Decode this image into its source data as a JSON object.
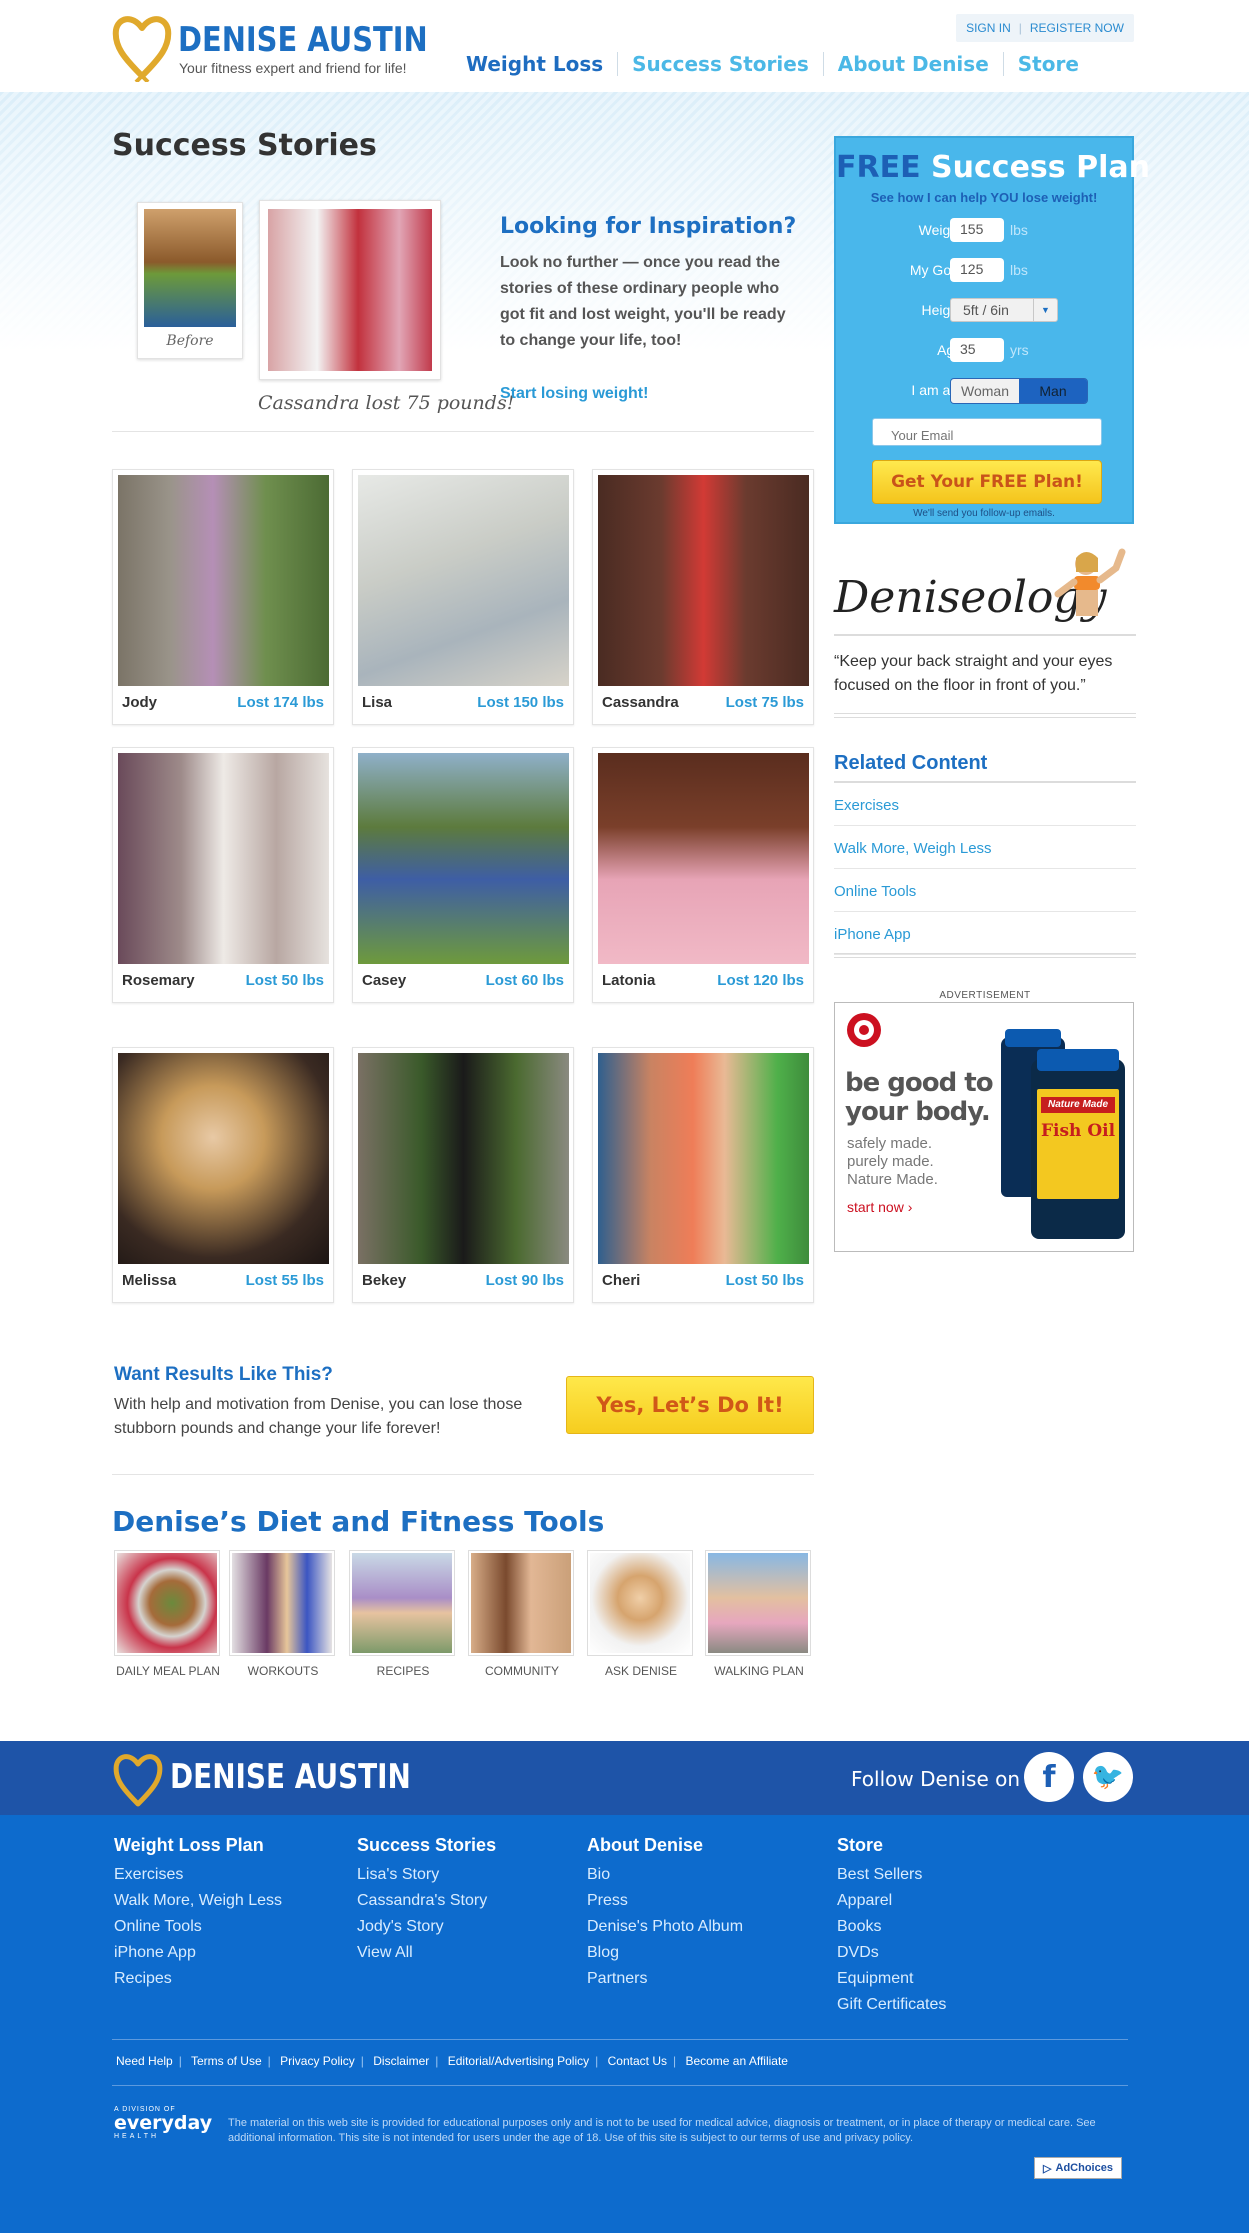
{
  "header": {
    "brand": "DENISE AUSTIN",
    "tagline": "Your fitness expert and friend for life!",
    "sign_in": "SIGN IN",
    "register": "REGISTER NOW",
    "nav": [
      "Weight Loss",
      "Success Stories",
      "About Denise",
      "Store"
    ],
    "active_nav": "Weight Loss"
  },
  "page": {
    "title": "Success Stories",
    "hero": {
      "before_caption": "Before",
      "after_caption": "Cassandra lost 75 pounds!",
      "heading": "Looking for Inspiration?",
      "body": "Look no further — once you read the stories of these ordinary people who got fit and lost weight, you'll be ready to change your life, too!",
      "link": "Start losing weight!"
    },
    "stories": [
      {
        "name": "Jody",
        "lost": "Lost 174 lbs"
      },
      {
        "name": "Lisa",
        "lost": "Lost 150 lbs"
      },
      {
        "name": "Cassandra",
        "lost": "Lost 75 lbs"
      },
      {
        "name": "Rosemary",
        "lost": "Lost 50 lbs"
      },
      {
        "name": "Casey",
        "lost": "Lost 60 lbs"
      },
      {
        "name": "Latonia",
        "lost": "Lost 120 lbs"
      },
      {
        "name": "Melissa",
        "lost": "Lost 55 lbs"
      },
      {
        "name": "Bekey",
        "lost": "Lost 90 lbs"
      },
      {
        "name": "Cheri",
        "lost": "Lost 50 lbs"
      }
    ],
    "cta": {
      "heading": "Want Results Like This?",
      "body": "With help and motivation from Denise, you can lose those stubborn pounds and change your life forever!",
      "button": "Yes, Let’s Do It!"
    },
    "tools": {
      "heading": "Denise’s Diet and Fitness Tools",
      "items": [
        "DAILY MEAL PLAN",
        "WORKOUTS",
        "RECIPES",
        "COMMUNITY",
        "ASK DENISE",
        "WALKING PLAN"
      ]
    }
  },
  "sidebar": {
    "plan": {
      "title_free": "FREE",
      "title_rest": "Success Plan",
      "subtitle": "See how I can help YOU lose weight!",
      "weight_label": "Weight",
      "weight_value": "155",
      "weight_unit": "lbs",
      "goal_label": "My Goal",
      "goal_value": "125",
      "goal_unit": "lbs",
      "height_label": "Height",
      "height_value": "5ft / 6in",
      "age_label": "Age",
      "age_value": "35",
      "age_unit": "yrs",
      "gender_label": "I am a...",
      "gender_options": [
        "Woman",
        "Man"
      ],
      "gender_selected": "Man",
      "email_placeholder": "Your Email",
      "button": "Get Your FREE Plan!",
      "note": "We'll send you follow-up emails."
    },
    "deniseology": {
      "logo": "Deniseology",
      "quote": "“Keep your back straight and your eyes focused on the floor in front of you.”"
    },
    "related": {
      "heading": "Related Content",
      "items": [
        "Exercises",
        "Walk More, Weigh Less",
        "Online Tools",
        "iPhone App"
      ]
    },
    "ad": {
      "label": "ADVERTISEMENT",
      "headline": "be good to your body.",
      "sub": "safely made. purely made. Nature Made.",
      "cta": "start now ›",
      "bottle_brand": "Nature Made",
      "bottle_product": "Fish Oil"
    }
  },
  "footer": {
    "brand": "DENISE AUSTIN",
    "follow": "Follow Denise on",
    "columns": [
      {
        "heading": "Weight Loss Plan",
        "links": [
          "Exercises",
          "Walk More, Weigh Less",
          "Online Tools",
          "iPhone App",
          "Recipes"
        ]
      },
      {
        "heading": "Success Stories",
        "links": [
          "Lisa's Story",
          "Cassandra's Story",
          "Jody's Story",
          "View All"
        ]
      },
      {
        "heading": "About Denise",
        "links": [
          "Bio",
          "Press",
          "Denise's Photo Album",
          "Blog",
          "Partners"
        ]
      },
      {
        "heading": "Store",
        "links": [
          "Best Sellers",
          "Apparel",
          "Books",
          "DVDs",
          "Equipment",
          "Gift Certificates"
        ]
      }
    ],
    "legal": [
      "Need Help",
      "Terms of Use",
      "Privacy Policy",
      "Disclaimer",
      "Editorial/Advertising Policy",
      "Contact Us",
      "Become an Affiliate"
    ],
    "everyday_small": "A DIVISION OF",
    "everyday_big": "everyday",
    "everyday_health": "HEALTH",
    "disclaimer": "The material on this web site is provided for educational purposes only and is not to be used for medical advice, diagnosis or treatment, or in place of therapy or medical care. See additional information. This site is not intended for users under the age of 18. Use of this site is subject to our terms of use and privacy policy.",
    "adchoices": "AdChoices"
  },
  "colors": {
    "brand_blue": "#1d6fc2",
    "link_blue": "#2a9ad6",
    "plan_blue": "#49b7eb",
    "cta_yellow": "#f6cd1f",
    "footer_blue": "#0d6bcd",
    "footer_top": "#1e54a8"
  }
}
